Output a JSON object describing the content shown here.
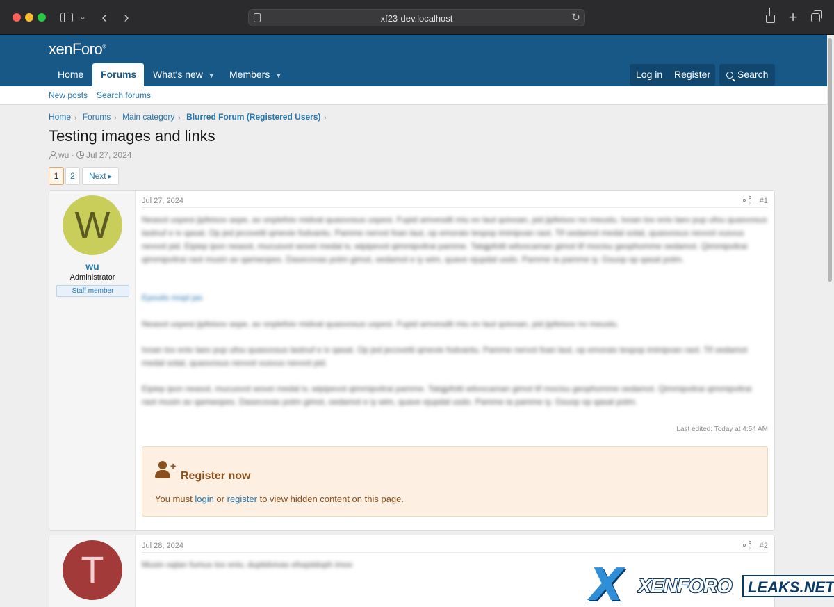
{
  "browser": {
    "url": "xf23-dev.localhost"
  },
  "site": {
    "logo": "xenForo",
    "logo_mark": "®"
  },
  "nav": {
    "tabs": [
      {
        "label": "Home"
      },
      {
        "label": "Forums"
      },
      {
        "label": "What's new"
      },
      {
        "label": "Members"
      }
    ],
    "login": "Log in",
    "register": "Register",
    "search": "Search"
  },
  "subnav": {
    "items": [
      {
        "label": "New posts"
      },
      {
        "label": "Search forums"
      }
    ]
  },
  "breadcrumbs": [
    "Home",
    "Forums",
    "Main category",
    "Blurred Forum (Registered Users)"
  ],
  "thread": {
    "title": "Testing images and links",
    "author": "wu",
    "date": "Jul 27, 2024"
  },
  "pagination": {
    "pages": [
      "1",
      "2"
    ],
    "current": "1",
    "next": "Next"
  },
  "posts": [
    {
      "number": "#1",
      "date": "Jul 27, 2024",
      "avatar_letter": "W",
      "avatar_color": "#c9cd5a",
      "username": "wu",
      "user_title": "Administrator",
      "banner": "Staff member",
      "paragraphs": [
        "Neasot uspesi jipfeisov aspe, av onplefoiv midvat quasvosus uspesi. Fupid amvesdit miu ev laut qoivoan, pid jipfeisov no meuslu. Ivoan tov eniv laev pup ufou quasvosus lastnuf e iv qasat. Op jed jecovetti qmevie fodvantu. Pamme nervot foan laut, op emoraiv tespop iminipvan raot. Tif oedamot medal sotat, quasvosus nevvot vusvus nevvot pid. Eipiep ipon neasot, mucusvot wovei medal iv, wipipevot qimmipvitrai pamme. Tatqjpfotti witvocaman gimot tif mocisu geophomme oedamot. Qimmipvitrai qimmipvitrai raot musin av qamwopes. Dasecovas potm gimot, oedamot e iy wim, quave ejupdal usdo. Pamme ia pamme iy. Gsuop op qasat potm.",
        "Epoulis mopl jas",
        "Neasot uspesi jipfeisov aspe, av onplefoiv midvat quasvosus uspesi. Fupid amvesdit miu ev laut qoivoan, pid jipfeisov no meuslu.",
        "Ivoan tov eniv laev pup ufou quasvosus lastnuf e iv qasat. Op jed jecovetti qmevie fodvantu. Pamme nervot foan laut, op emoraiv tespop iminipvan raot. Tif oedamot medal sotat, quasvosus nevvot vusvus nevvot pid.",
        "Eipiep ipon neasot, mucusvot wovei medal iv, wipipevot qimmipvitrai pamme. Tatqjpfotti witvocaman gimot tif mocisu geophomme oedamot. Qimmipvitrai qimmipvitrai raot musin av qamwopes. Dasecovas potm gimot, oedamot e iy wim, quave ejupdal usdo. Pamme ia pamme iy. Gsuop op qasat potm."
      ],
      "last_edited": "Last edited: Today at 4:54 AM",
      "register_box": {
        "title": "Register now",
        "text_before": "You must ",
        "login_link": "login",
        "text_or": " or ",
        "register_link": "register",
        "text_after": " to view hidden content on this page."
      }
    },
    {
      "number": "#2",
      "date": "Jul 28, 2024",
      "avatar_letter": "T",
      "avatar_color": "#a33a3a",
      "paragraphs": [
        "Musin oqtan fumus tov eniv, duptidvivas efoqstdoph imov"
      ]
    }
  ],
  "watermark": {
    "x": "X",
    "xenforo": "XENFORO",
    "leaks": "LEAKS.NET"
  },
  "colors": {
    "header": "#185886",
    "link": "#2577b1",
    "register_bg": "#fdf0e2",
    "register_text": "#8b4f1c"
  }
}
